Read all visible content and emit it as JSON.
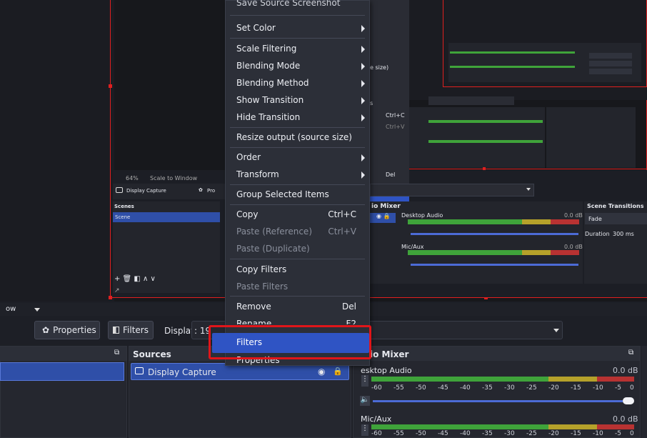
{
  "preview": {
    "zoom": "64%",
    "scale_mode": "Scale to Window",
    "source_name": "Display Capture",
    "props_short": "Pro",
    "scenes_header": "Scenes",
    "scene_item": "Scene",
    "mini_mixer_title": "io Mixer",
    "mini_transitions_title": "Scene Transitions",
    "mini_desktop_audio": "Desktop Audio",
    "mini_db": "0.0 dB",
    "mini_fade": "Fade",
    "mini_duration": "Duration",
    "mini_duration_val": "300 ms",
    "mini_micaux": "Mic/Aux",
    "mini_menu_size_tail": "e size)",
    "mini_menu_s_tail": "s",
    "mini_copy_sc": "Ctrl+C",
    "mini_paste_sc": "Ctrl+V",
    "mini_del_sc": "Del",
    "mini_f2_sc": "F2"
  },
  "toolbar": {
    "scale_left": "ow",
    "properties_label": "Properties",
    "filters_label": "Filters",
    "display_label": "Display",
    "display_value": ": 19"
  },
  "docks": {
    "sources_title": "Sources",
    "source_item": "Display Capture",
    "mixer_title": "io Mixer",
    "desktop_audio": "esktop Audio",
    "desktop_db": "0.0 dB",
    "mic_aux": "Mic/Aux",
    "mic_db": "0.0 dB",
    "ticks": [
      "-60",
      "-55",
      "-50",
      "-45",
      "-40",
      "-35",
      "-30",
      "-25",
      "-20",
      "-15",
      "-10",
      "-5",
      "0"
    ]
  },
  "context_menu": {
    "top_clipped": "Save Source Screenshot",
    "set_color": "Set Color",
    "scale_filtering": "Scale Filtering",
    "blending_mode": "Blending Mode",
    "blending_method": "Blending Method",
    "show_transition": "Show Transition",
    "hide_transition": "Hide Transition",
    "resize_output": "Resize output (source size)",
    "order": "Order",
    "transform": "Transform",
    "group_selected": "Group Selected Items",
    "copy": "Copy",
    "copy_sc": "Ctrl+C",
    "paste_reference": "Paste (Reference)",
    "paste_reference_sc": "Ctrl+V",
    "paste_duplicate": "Paste (Duplicate)",
    "copy_filters": "Copy Filters",
    "paste_filters": "Paste Filters",
    "remove": "Remove",
    "remove_sc": "Del",
    "rename": "Rename",
    "rename_sc": "F2",
    "filters": "Filters",
    "properties": "Properties"
  },
  "colors": {
    "accent": "#2f54c4",
    "highlight_box": "#e0151a",
    "meter_green": "#3fa33a",
    "meter_yellow": "#b5a12a",
    "meter_red": "#b83232"
  }
}
